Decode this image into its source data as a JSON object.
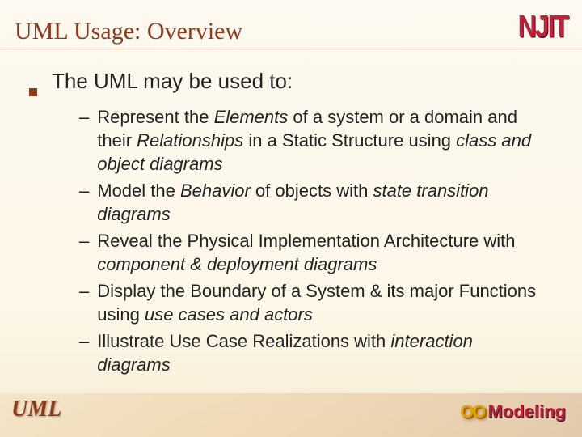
{
  "logo": "NJIT",
  "title": "UML Usage: Overview",
  "lead": "The UML may be used to:",
  "items": [
    {
      "parts": [
        "Represent the ",
        {
          "em": "Elements"
        },
        " of a system or a domain and their ",
        {
          "em": "Relationships"
        },
        " in a  Static Structure using ",
        {
          "em": "class and object diagrams"
        }
      ]
    },
    {
      "parts": [
        "Model the ",
        {
          "em": "Behavior"
        },
        " of objects with ",
        {
          "em": "state transition diagrams"
        }
      ]
    },
    {
      "parts": [
        "Reveal the Physical Implementation Architecture with ",
        {
          "em": "component & deployment diagrams"
        }
      ]
    },
    {
      "parts": [
        "Display the Boundary of a System & its major Functions using ",
        {
          "em": "use cases and actors"
        }
      ]
    },
    {
      "parts": [
        "Illustrate Use Case Realizations with ",
        {
          "em": "interaction diagrams"
        }
      ]
    }
  ],
  "footer": {
    "uml": "UML",
    "brand_oo": "OO ",
    "brand_mod": "Modeling"
  }
}
